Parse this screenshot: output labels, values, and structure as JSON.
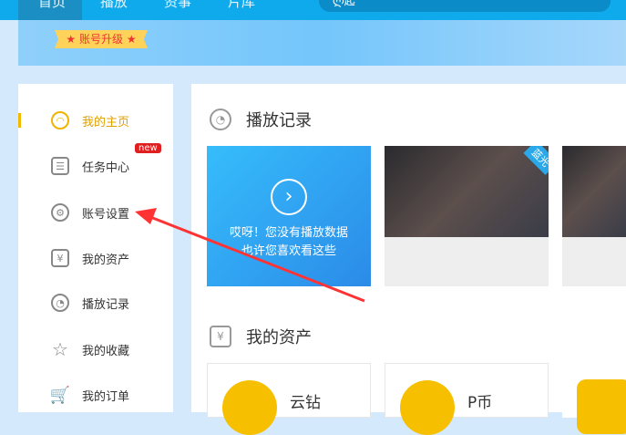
{
  "topnav": {
    "items": [
      "首页",
      "播放",
      "资事",
      "片库"
    ],
    "search_value": "ლ起"
  },
  "banner": {
    "upgrade_label": "账号升级"
  },
  "sidebar": {
    "items": [
      {
        "label": "我的主页",
        "icon": "user-icon",
        "active": true
      },
      {
        "label": "任务中心",
        "icon": "task-icon",
        "badge": "new"
      },
      {
        "label": "账号设置",
        "icon": "gear-icon"
      },
      {
        "label": "我的资产",
        "icon": "yen-icon"
      },
      {
        "label": "播放记录",
        "icon": "clock-icon"
      },
      {
        "label": "我的收藏",
        "icon": "star-icon"
      },
      {
        "label": "我的订单",
        "icon": "cart-icon"
      }
    ]
  },
  "history": {
    "title": "播放记录",
    "empty_line1": "哎呀！您没有播放数据",
    "empty_line2": "也许您喜欢看这些",
    "tag": "蓝光"
  },
  "assets": {
    "title": "我的资产",
    "items": [
      "云钻",
      "P币"
    ]
  },
  "colors": {
    "accent": "#0eaaeb",
    "active": "#f5b800",
    "annotation": "#ff3333"
  }
}
